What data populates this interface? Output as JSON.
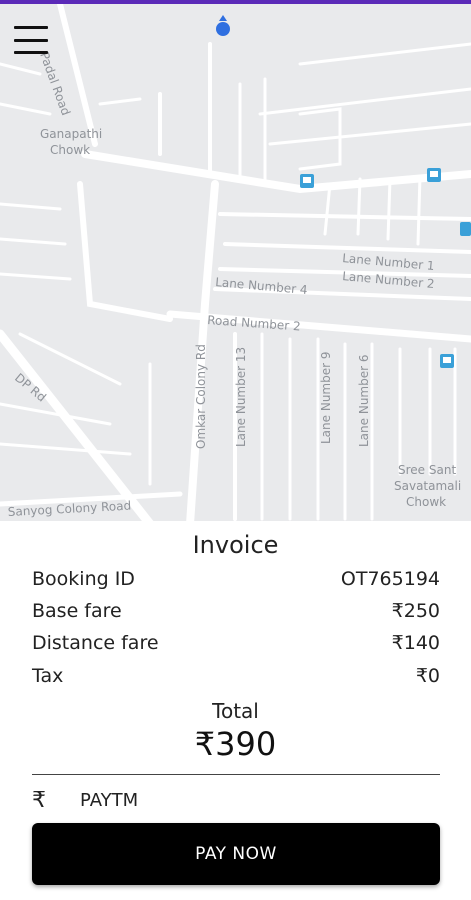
{
  "map": {
    "labels": {
      "road_padal": "Padal Road",
      "ganapathi_1": "Ganapathi",
      "ganapathi_2": "Chowk",
      "lane1": "Lane Number 1",
      "lane2": "Lane Number 2",
      "lane4": "Lane Number 4",
      "road2": "Road Number 2",
      "dp_road": "DP Rd",
      "omkar": "Omkar Colony Rd",
      "lane13": "Lane Number 13",
      "lane9": "Lane Number 9",
      "lane6": "Lane Number 6",
      "sree_1": "Sree Sant",
      "sree_2": "Savatamali",
      "sree_3": "Chowk",
      "sanyog": "Sanyog Colony Road"
    }
  },
  "invoice": {
    "title": "Invoice",
    "rows": [
      {
        "label": "Booking ID",
        "value": "OT765194"
      },
      {
        "label": "Base fare",
        "value": "₹250"
      },
      {
        "label": "Distance fare",
        "value": "₹140"
      },
      {
        "label": "Tax",
        "value": "₹0"
      }
    ],
    "total_label": "Total",
    "total_value": "₹390",
    "payment_icon": "₹",
    "payment_method": "PAYTM",
    "pay_button": "PAY NOW"
  },
  "colors": {
    "accent_bar": "#5b2ab8",
    "button_bg": "#000000",
    "location_dot": "#2f6fe0"
  }
}
